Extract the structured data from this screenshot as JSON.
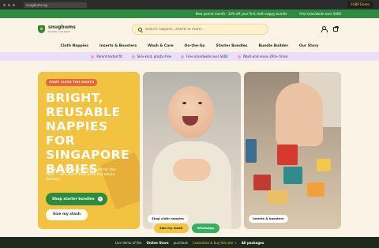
{
  "browser": {
    "url": "snugbums.sg",
    "demo_chip": "SGBP Demo"
  },
  "promo": {
    "text_1": "New parent month · 10% off your first cloth nappy bundle",
    "text_2": "Free islandwide over S$60"
  },
  "header": {
    "logo_name": "snugbums",
    "logo_tag": "Reusable. Leak-tested.",
    "search_placeholder": "Search nappies, inserts & more..."
  },
  "nav": {
    "items": [
      "Cloth Nappies",
      "Inserts & Boosters",
      "Wash & Care",
      "On-the-Go",
      "Starter Bundles",
      "Bundle Builder",
      "Our Story"
    ]
  },
  "usp": {
    "items": [
      "Parent-tested fit",
      "Skin-kind, plastic-free",
      "Free islandwide over S$60",
      "Wash-and-reuse 200+ times"
    ]
  },
  "hero": {
    "eyebrow": "START CLOTH THIS MONTH",
    "title": "BRIGHT, REUSABLE NAPPIES FOR SINGAPORE BABIES",
    "subtitle": "Skin-kind, plastic-free and built for the heat — one stash that lasts the whole journey.",
    "primary_button": "Shop starter bundles",
    "secondary_button": "Size my stash",
    "primary_arrow": "→"
  },
  "cards": {
    "baby_label": "Shop cloth nappies",
    "blocks_label": "Inserts & boosters"
  },
  "sticky": {
    "size_label": "Size my stash",
    "whatsapp_label": "WhatsApp"
  },
  "demo_bar": {
    "prefix": "Live demo of the",
    "product": "Online Store",
    "suffix": "purchase",
    "link": "Customise & buy this site →",
    "all": "All packages"
  },
  "colors": {
    "brand_green": "#2e8a3e",
    "hero_yellow": "#f2c241",
    "accent_orange": "#e8673a",
    "usp_lavender": "#e9defb"
  }
}
